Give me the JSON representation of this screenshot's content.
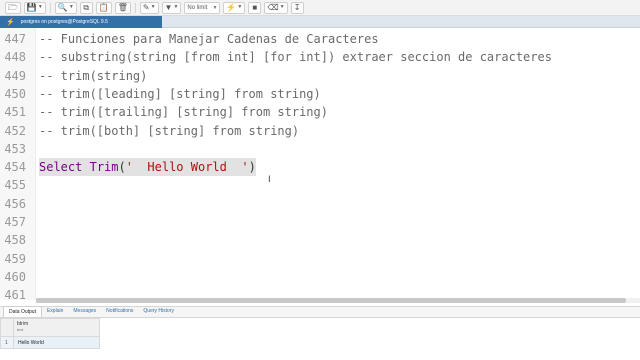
{
  "toolbar": {
    "limit_label": "No limit"
  },
  "connection": {
    "label": "postgres on postgres@PostgreSQL 9.5"
  },
  "editor": {
    "lines": [
      {
        "no": "447",
        "segments": [
          {
            "t": "-- Funciones para Manejar Cadenas de Caracteres",
            "c": "cm-comment"
          }
        ]
      },
      {
        "no": "448",
        "segments": [
          {
            "t": "-- substring(string [from int] [for int]) extraer seccion de caracteres",
            "c": "cm-comment"
          }
        ]
      },
      {
        "no": "449",
        "segments": [
          {
            "t": "-- trim(string)",
            "c": "cm-comment"
          }
        ]
      },
      {
        "no": "450",
        "segments": [
          {
            "t": "-- trim([leading] [string] from string)",
            "c": "cm-comment"
          }
        ]
      },
      {
        "no": "451",
        "segments": [
          {
            "t": "-- trim([trailing] [string] from string)",
            "c": "cm-comment"
          }
        ]
      },
      {
        "no": "452",
        "segments": [
          {
            "t": "-- trim([both] [string] from string)",
            "c": "cm-comment"
          }
        ]
      },
      {
        "no": "453",
        "segments": []
      },
      {
        "no": "454",
        "highlight": true,
        "segments": [
          {
            "t": "Select",
            "c": "cm-kw"
          },
          {
            "t": " ",
            "c": "cm-punc"
          },
          {
            "t": "Trim",
            "c": "cm-kw"
          },
          {
            "t": "(",
            "c": "cm-punc"
          },
          {
            "t": "'  Hello World  '",
            "c": "cm-str"
          },
          {
            "t": ")",
            "c": "cm-punc"
          }
        ]
      },
      {
        "no": "455",
        "segments": []
      },
      {
        "no": "456",
        "segments": []
      },
      {
        "no": "457",
        "segments": []
      },
      {
        "no": "458",
        "segments": []
      },
      {
        "no": "459",
        "segments": []
      },
      {
        "no": "460",
        "segments": []
      },
      {
        "no": "461",
        "segments": []
      }
    ]
  },
  "results": {
    "tabs": [
      {
        "label": "Data Output",
        "active": true
      },
      {
        "label": "Explain",
        "active": false
      },
      {
        "label": "Messages",
        "active": false
      },
      {
        "label": "Notifications",
        "active": false
      },
      {
        "label": "Query History",
        "active": false
      }
    ],
    "columns": [
      {
        "name": "btrim",
        "type": "text"
      }
    ],
    "rows": [
      {
        "num": "1",
        "cells": [
          "Hello World"
        ]
      }
    ]
  },
  "icons": {
    "toolbar": [
      "open-file-icon",
      "save-icon",
      "find-icon",
      "copy-icon",
      "paste-icon",
      "delete-icon",
      "edit-icon",
      "filter-icon",
      "execute-icon",
      "stop-icon",
      "clear-icon",
      "download-icon"
    ],
    "connection": "plug-icon"
  }
}
